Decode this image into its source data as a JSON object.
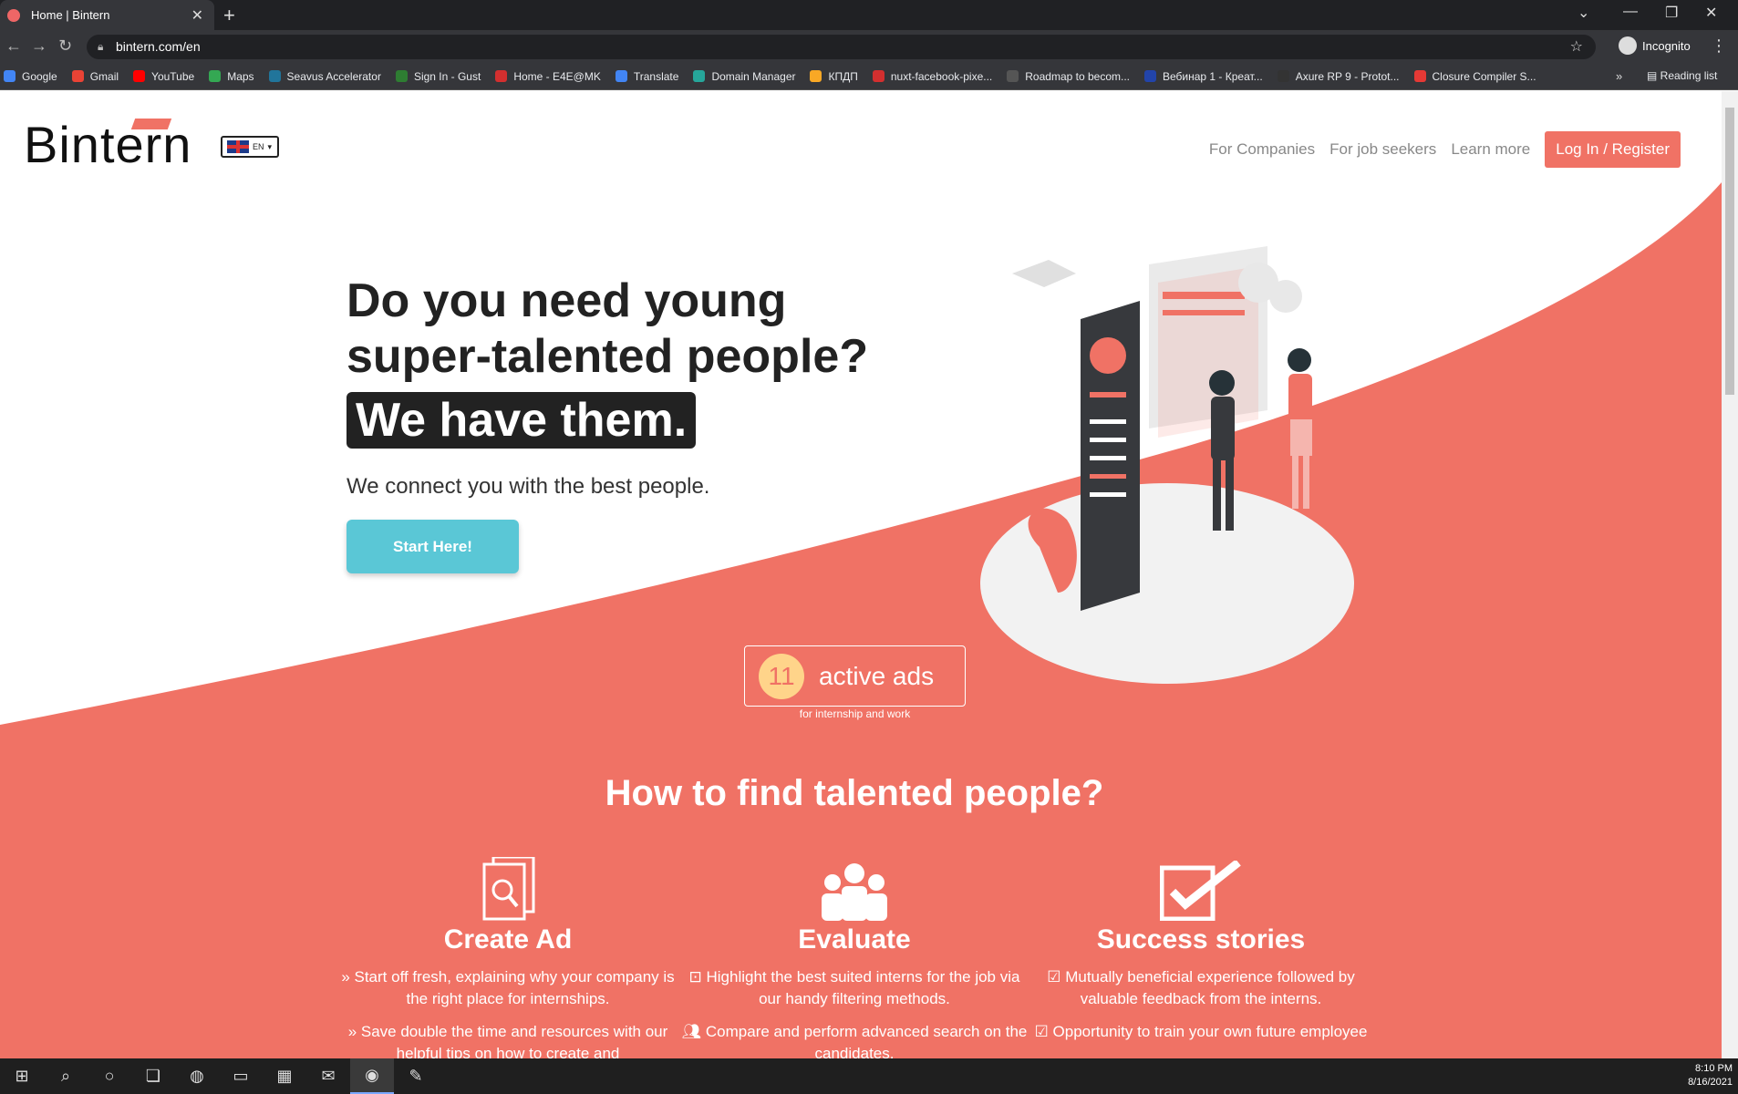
{
  "browser": {
    "tab_title": "Home | Bintern",
    "tab_close": "✕",
    "new_tab": "+",
    "url": "bintern.com/en",
    "profile": "Incognito",
    "bookmarks": [
      "Google",
      "Gmail",
      "YouTube",
      "Maps",
      "Seavus Accelerator",
      "Sign In - Gust",
      "Home - E4E@MK",
      "Translate",
      "Domain Manager",
      "КПДП",
      "nuxt-facebook-pixe...",
      "Roadmap to becom...",
      "Вебинар 1 - Креат...",
      "Axure RP 9 - Protot...",
      "Closure Compiler S..."
    ],
    "bookmark_colors": [
      "#4285f4",
      "#ea4335",
      "#ff0000",
      "#34a853",
      "#21759b",
      "#2e7d32",
      "#d32f2f",
      "#4285f4",
      "#26a69a",
      "#f9a825",
      "#d32f2f",
      "#555",
      "#2244aa",
      "#333",
      "#e53935"
    ],
    "more_bookmarks": "»",
    "reading_list": "Reading list"
  },
  "site": {
    "logo": "Bintern",
    "lang": "EN",
    "nav": [
      "For Companies",
      "For job seekers",
      "Learn more"
    ],
    "login": "Log In / Register",
    "hero_line1": "Do you need young super-talented people?",
    "hero_line2": "We have them.",
    "hero_sub": "We connect you with the best people.",
    "cta": "Start Here!",
    "ads_count": "11",
    "ads_label": "active ads",
    "ads_sub": "for internship and work",
    "section_title": "How to find talented people?",
    "features": [
      {
        "title": "Create Ad",
        "lines": [
          "» Start off fresh, explaining why your company is the right place for internships.",
          "» Save double the time and resources with our helpful tips on how to create and"
        ]
      },
      {
        "title": "Evaluate",
        "lines": [
          "Highlight the best suited interns for the job via our handy filtering methods.",
          "Compare and perform advanced search on the candidates."
        ]
      },
      {
        "title": "Success stories",
        "lines": [
          "☑ Mutually beneficial experience followed by valuable feedback from the interns.",
          "☑ Opportunity to train your own future employee"
        ]
      }
    ],
    "colors": {
      "accent": "#f07265",
      "cta": "#5ac7d6",
      "dark": "#222222"
    }
  },
  "taskbar": {
    "time": "8:10 PM",
    "date": "8/16/2021"
  }
}
